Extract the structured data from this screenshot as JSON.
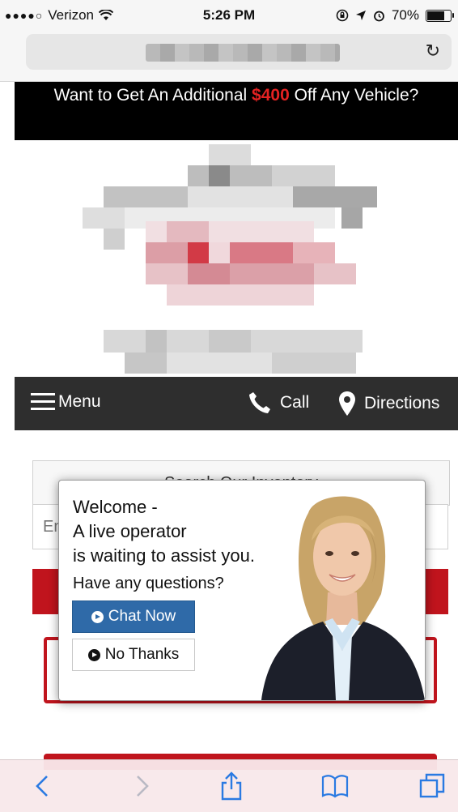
{
  "status_bar": {
    "carrier": "Verizon",
    "time": "5:26 PM",
    "battery": "70%",
    "battery_level": 0.7
  },
  "promo": {
    "text_before": "Want to Get An Additional ",
    "amount": "$400",
    "text_after": " Off Any Vehicle?",
    "amount_color": "#e42222"
  },
  "nav": {
    "menu_label": "Menu",
    "call_label": "Call",
    "directions_label": "Directions"
  },
  "page": {
    "search_heading": "Search Our Inventory",
    "search_placeholder": "Enter"
  },
  "chat": {
    "line1": "Welcome -",
    "line2": "A live operator",
    "line3": "is waiting to assist you.",
    "question": "Have any questions?",
    "chat_now_label": "Chat Now",
    "no_thanks_label": "No Thanks"
  },
  "colors": {
    "nav_bg": "#2e2e2e",
    "accent_red": "#c0141d",
    "chat_button": "#2f6aa8"
  }
}
